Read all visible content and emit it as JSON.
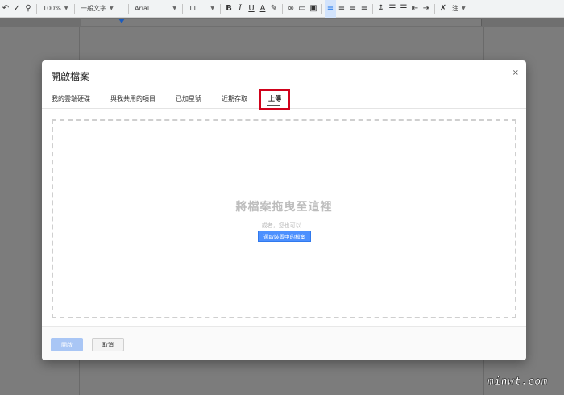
{
  "toolbar": {
    "zoom": "100%",
    "style": "一般文字",
    "font": "Arial",
    "font_size": "11",
    "bold": "B",
    "italic": "I",
    "underline": "U",
    "text_color": "A",
    "more": "注"
  },
  "dialog": {
    "title": "開啟檔案",
    "close": "×",
    "tabs": [
      {
        "label": "我的雲端硬碟"
      },
      {
        "label": "與我共用的項目"
      },
      {
        "label": "已加星號"
      },
      {
        "label": "近期存取"
      },
      {
        "label": "上傳"
      }
    ],
    "active_tab": "上傳",
    "dropzone": {
      "title": "將檔案拖曳至這裡",
      "or_text": "或者，您也可以...",
      "select_button": "選取裝置中的檔案"
    },
    "footer": {
      "open_button": "開啟",
      "cancel_button": "取消"
    }
  },
  "watermark": "minwt.com",
  "colors": {
    "accent_blue": "#4d90fe",
    "highlight_red": "#d0021b",
    "overlay_gray": "#7c7c7c"
  }
}
